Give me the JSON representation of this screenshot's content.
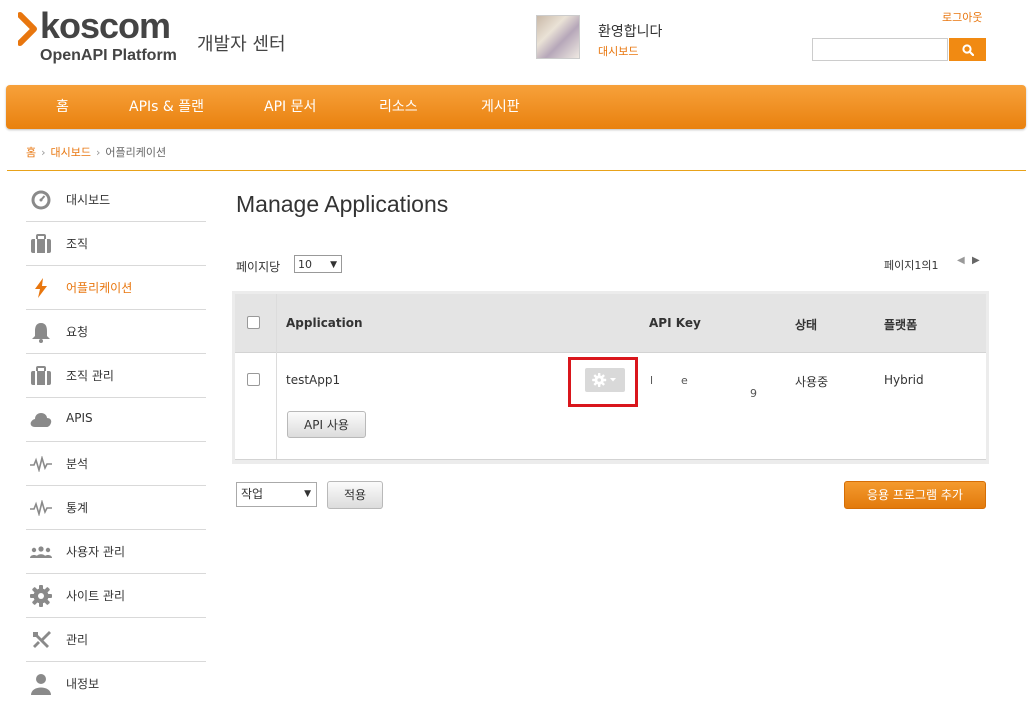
{
  "header": {
    "logo_name": "koscom",
    "logo_sub": "OpenAPI Platform",
    "dev_center": "개발자 센터",
    "welcome": "환영합니다",
    "dashboard_link": "대시보드",
    "logout": "로그아웃",
    "search": {
      "value": "",
      "placeholder": "",
      "icon": "search-icon"
    }
  },
  "nav": {
    "items": [
      "홈",
      "APIs & 플랜",
      "API 문서",
      "리소스",
      "게시판"
    ]
  },
  "breadcrumb": [
    "홈",
    "대시보드",
    "어플리케이션"
  ],
  "sidebar": {
    "items": [
      {
        "label": "대시보드",
        "icon": "dashboard-icon"
      },
      {
        "label": "조직",
        "icon": "briefcase-icon"
      },
      {
        "label": "어플리케이션",
        "icon": "bolt-icon",
        "active": true
      },
      {
        "label": "요청",
        "icon": "bell-icon"
      },
      {
        "label": "조직 관리",
        "icon": "briefcase-icon"
      },
      {
        "label": "APIS",
        "icon": "cloud-icon"
      },
      {
        "label": "분석",
        "icon": "pulse-icon"
      },
      {
        "label": "통계",
        "icon": "pulse-icon"
      },
      {
        "label": "사용자 관리",
        "icon": "users-icon"
      },
      {
        "label": "사이트 관리",
        "icon": "gear-icon"
      },
      {
        "label": "관리",
        "icon": "tools-icon"
      },
      {
        "label": "내정보",
        "icon": "user-icon"
      }
    ]
  },
  "main": {
    "title": "Manage Applications",
    "per_page_label": "페이지당",
    "per_page_value": "10",
    "pager_text": "페이지1의1",
    "table": {
      "headers": {
        "application": "Application",
        "api_key": "API Key",
        "status": "상태",
        "platform": "플랫폼"
      },
      "rows": [
        {
          "application": "testApp1",
          "api_key_top": "l        e",
          "api_key_bottom": "9",
          "status": "사용중",
          "platform": "Hybrid",
          "api_button": "API 사용"
        }
      ]
    },
    "action_select": "작업",
    "apply_button": "적용",
    "add_button": "응용 프로그램 추가"
  },
  "colors": {
    "accent": "#e8760e",
    "nav": "#f18a12",
    "highlight": "#d9161c"
  }
}
